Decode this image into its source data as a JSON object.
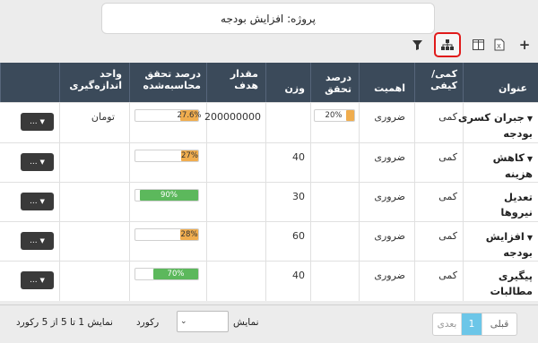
{
  "title": "پروژه: افزایش بودجه",
  "toolbar": {
    "add_icon": "plus-icon",
    "excel_icon": "excel-export-icon",
    "columns_icon": "columns-icon",
    "tree_icon": "tree-hierarchy-icon",
    "filter_icon": "filter-icon"
  },
  "columns": {
    "title": "عنوان",
    "type": "کمی/ کیفی",
    "importance": "اهمیت",
    "achieve_pct": "درصد تحقق",
    "weight": "وزن",
    "target": "مقدار هدف",
    "calc_pct": "درصد تحقق محاسبه‌شده",
    "unit": "واحد اندازه‌گیری"
  },
  "rows": [
    {
      "name_line1": "جبران کسری",
      "name_line2": "بودجه",
      "expandable": true,
      "type": "کمی",
      "importance": "ضروری",
      "achieve_pct": "20%",
      "achieve_frac": 0.2,
      "weight": "",
      "target": "200000000",
      "calc_pct": "27.6%",
      "calc_frac": 0.276,
      "calc_color": "orange",
      "unit": "تومان",
      "action": "..."
    },
    {
      "name_line1": "کاهش",
      "name_line2": "هزینه",
      "expandable": true,
      "type": "کمی",
      "importance": "ضروری",
      "achieve_pct": "",
      "weight": "40",
      "target": "",
      "calc_pct": "27%",
      "calc_frac": 0.27,
      "calc_color": "orange",
      "unit": "",
      "action": "..."
    },
    {
      "name_line1": "تعدیل",
      "name_line2": "نیروها",
      "expandable": false,
      "type": "کمی",
      "importance": "ضروری",
      "achieve_pct": "",
      "weight": "30",
      "target": "",
      "calc_pct": "90%",
      "calc_frac": 0.9,
      "calc_color": "green",
      "unit": "",
      "action": "..."
    },
    {
      "name_line1": "افزایش",
      "name_line2": "بودجه",
      "expandable": true,
      "type": "کمی",
      "importance": "ضروری",
      "achieve_pct": "",
      "weight": "60",
      "target": "",
      "calc_pct": "28%",
      "calc_frac": 0.28,
      "calc_color": "orange",
      "unit": "",
      "action": "..."
    },
    {
      "name_line1": "پیگیری",
      "name_line2": "مطالبات",
      "expandable": false,
      "type": "کمی",
      "importance": "ضروری",
      "achieve_pct": "",
      "weight": "40",
      "target": "",
      "calc_pct": "70%",
      "calc_frac": 0.7,
      "calc_color": "green",
      "unit": "",
      "action": "..."
    }
  ],
  "footer": {
    "prev": "قبلی",
    "current_page": "1",
    "next": "بعدی",
    "show_label": "نمایش",
    "records_label": "رکورد",
    "summary": "نمایش 1 تا 5 از 5 رکورد"
  }
}
